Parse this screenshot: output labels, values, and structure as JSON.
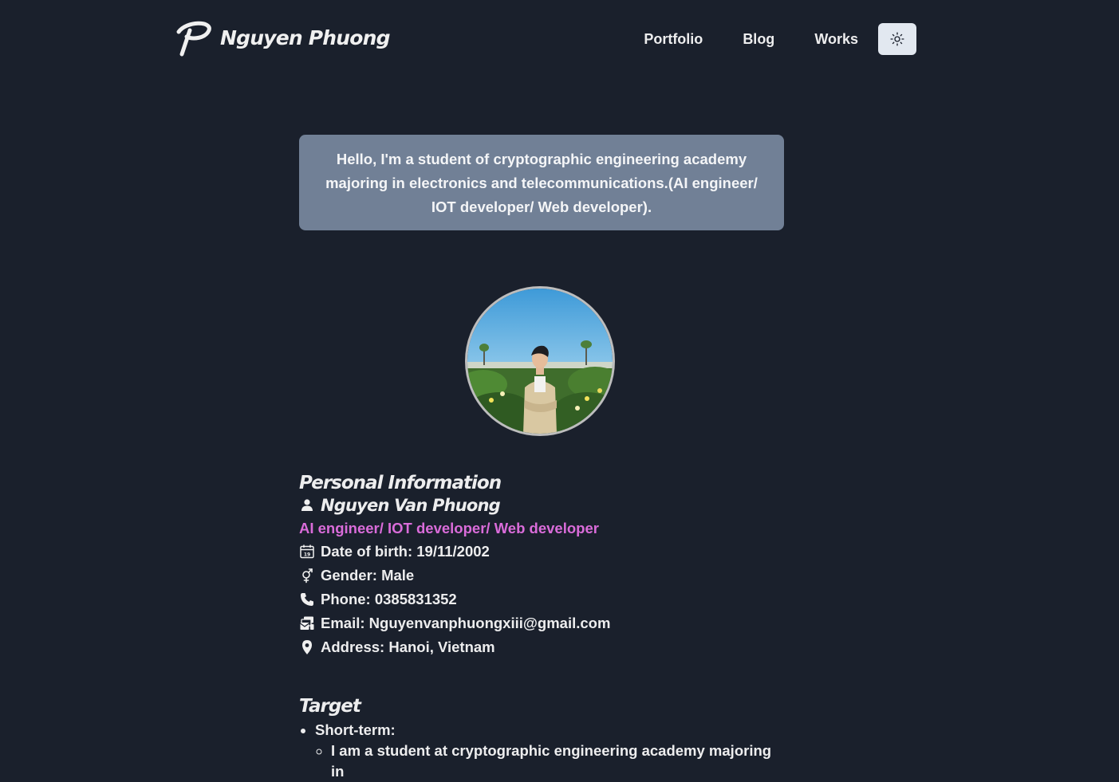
{
  "header": {
    "brand_name": "Nguyen Phuong",
    "nav": [
      {
        "label": "Portfolio"
      },
      {
        "label": "Blog"
      },
      {
        "label": "Works"
      }
    ],
    "theme_toggle_icon": "sun-icon"
  },
  "intro": {
    "text": "Hello, I'm a student of cryptographic engineering academy majoring in electronics and telecommunications.(AI engineer/ IOT developer/ Web developer)."
  },
  "personal": {
    "title": "Personal Information",
    "name": "Nguyen Van Phuong",
    "role": "AI engineer/ IOT developer/ Web developer",
    "dob": "Date of birth: 19/11/2002",
    "gender": "Gender: Male",
    "phone": "Phone: 0385831352",
    "email": "Email: Nguyenvanphuongxiii@gmail.com",
    "address": "Address: Hanoi, Vietnam"
  },
  "target": {
    "title": "Target",
    "items": [
      {
        "label": "Short-term:"
      }
    ],
    "sub_item_partial": "I am a student at cryptographic engineering academy majoring in"
  },
  "colors": {
    "background": "#1a202c",
    "intro_box": "#718096",
    "accent_role": "#da6cda",
    "toggle_bg": "#e2e8f0"
  }
}
